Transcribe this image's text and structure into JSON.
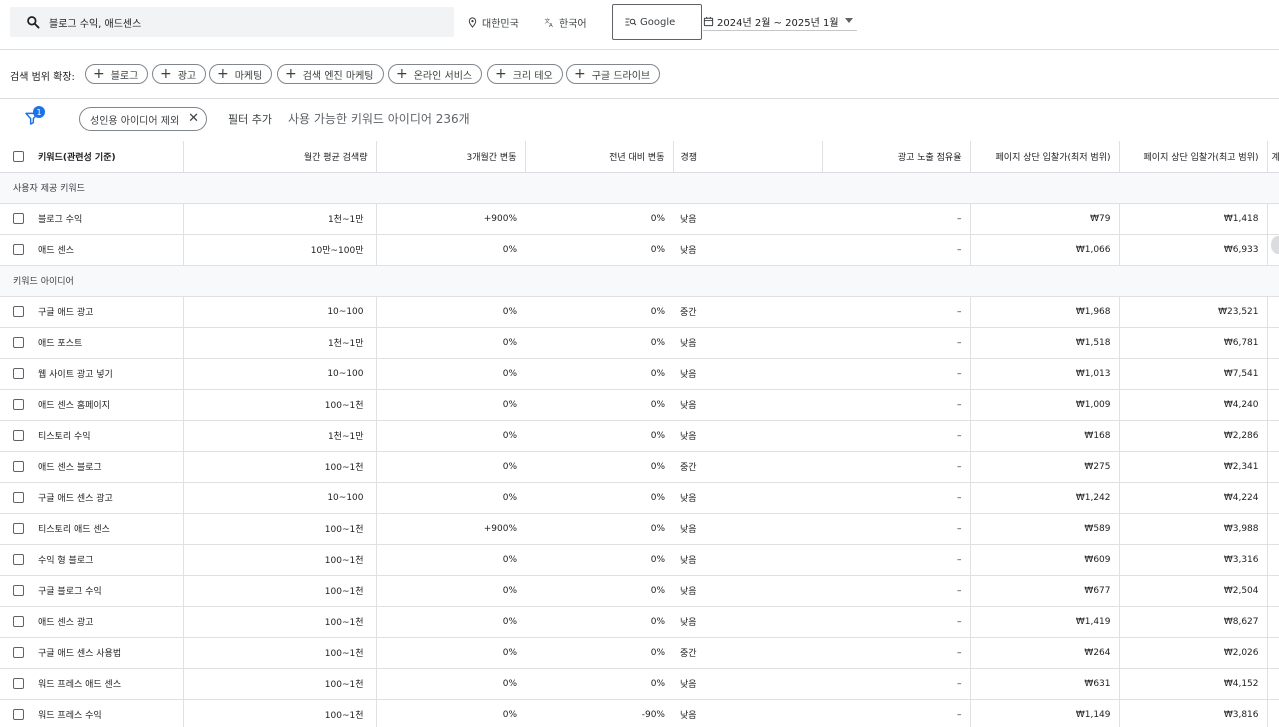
{
  "search": {
    "query": "블로그 수익, 애드센스"
  },
  "location": {
    "label": "대한민국"
  },
  "language": {
    "label": "한국어"
  },
  "network": {
    "label": "Google"
  },
  "date_range": {
    "label": "2024년 2월 ~ 2025년 1월"
  },
  "expand": {
    "label": "검색 범위 확장:",
    "chips": [
      "블로그",
      "광고",
      "마케팅",
      "검색 엔진 마케팅",
      "온라인 서비스",
      "크리 테오",
      "구글 드라이브"
    ]
  },
  "filter": {
    "badge": "1",
    "active_filter": "성인용 아이디어 제외",
    "add_filter": "필터 추가",
    "available": "사용 가능한 키워드 아이디어 236개"
  },
  "table": {
    "headers": [
      "키워드(관련성 기준)",
      "월간 평균 검색량",
      "3개월간 변동",
      "전년 대비 변동",
      "경쟁",
      "광고 노출 점유율",
      "페이지 상단 입찰가(최저 범위)",
      "페이지 상단 입찰가(최고 범위)",
      "계"
    ],
    "section_user": "사용자 제공 키워드",
    "section_ideas": "키워드 아이디어",
    "user_rows": [
      [
        "블로그 수익",
        "1천~1만",
        "+900%",
        "0%",
        "낮음",
        "–",
        "₩79",
        "₩1,418"
      ],
      [
        "애드 센스",
        "10만~100만",
        "0%",
        "0%",
        "낮음",
        "–",
        "₩1,066",
        "₩6,933"
      ]
    ],
    "idea_rows": [
      [
        "구글 애드 광고",
        "10~100",
        "0%",
        "0%",
        "중간",
        "–",
        "₩1,968",
        "₩23,521"
      ],
      [
        "애드 포스트",
        "1천~1만",
        "0%",
        "0%",
        "낮음",
        "–",
        "₩1,518",
        "₩6,781"
      ],
      [
        "웹 사이트 광고 넣기",
        "10~100",
        "0%",
        "0%",
        "낮음",
        "–",
        "₩1,013",
        "₩7,541"
      ],
      [
        "애드 센스 홈페이지",
        "100~1천",
        "0%",
        "0%",
        "낮음",
        "–",
        "₩1,009",
        "₩4,240"
      ],
      [
        "티스토리 수익",
        "1천~1만",
        "0%",
        "0%",
        "낮음",
        "–",
        "₩168",
        "₩2,286"
      ],
      [
        "애드 센스 블로그",
        "100~1천",
        "0%",
        "0%",
        "중간",
        "–",
        "₩275",
        "₩2,341"
      ],
      [
        "구글 애드 센스 광고",
        "10~100",
        "0%",
        "0%",
        "낮음",
        "–",
        "₩1,242",
        "₩4,224"
      ],
      [
        "티스토리 애드 센스",
        "100~1천",
        "+900%",
        "0%",
        "낮음",
        "–",
        "₩589",
        "₩3,988"
      ],
      [
        "수익 형 블로그",
        "100~1천",
        "0%",
        "0%",
        "낮음",
        "–",
        "₩609",
        "₩3,316"
      ],
      [
        "구글 블로그 수익",
        "100~1천",
        "0%",
        "0%",
        "낮음",
        "–",
        "₩677",
        "₩2,504"
      ],
      [
        "애드 센스 광고",
        "100~1천",
        "0%",
        "0%",
        "낮음",
        "–",
        "₩1,419",
        "₩8,627"
      ],
      [
        "구글 애드 센스 사용법",
        "100~1천",
        "0%",
        "0%",
        "중간",
        "–",
        "₩264",
        "₩2,026"
      ],
      [
        "워드 프레스 애드 센스",
        "100~1천",
        "0%",
        "0%",
        "낮음",
        "–",
        "₩631",
        "₩4,152"
      ],
      [
        "워드 프레스 수익",
        "100~1천",
        "0%",
        "-90%",
        "낮음",
        "–",
        "₩1,149",
        "₩3,816"
      ]
    ]
  }
}
